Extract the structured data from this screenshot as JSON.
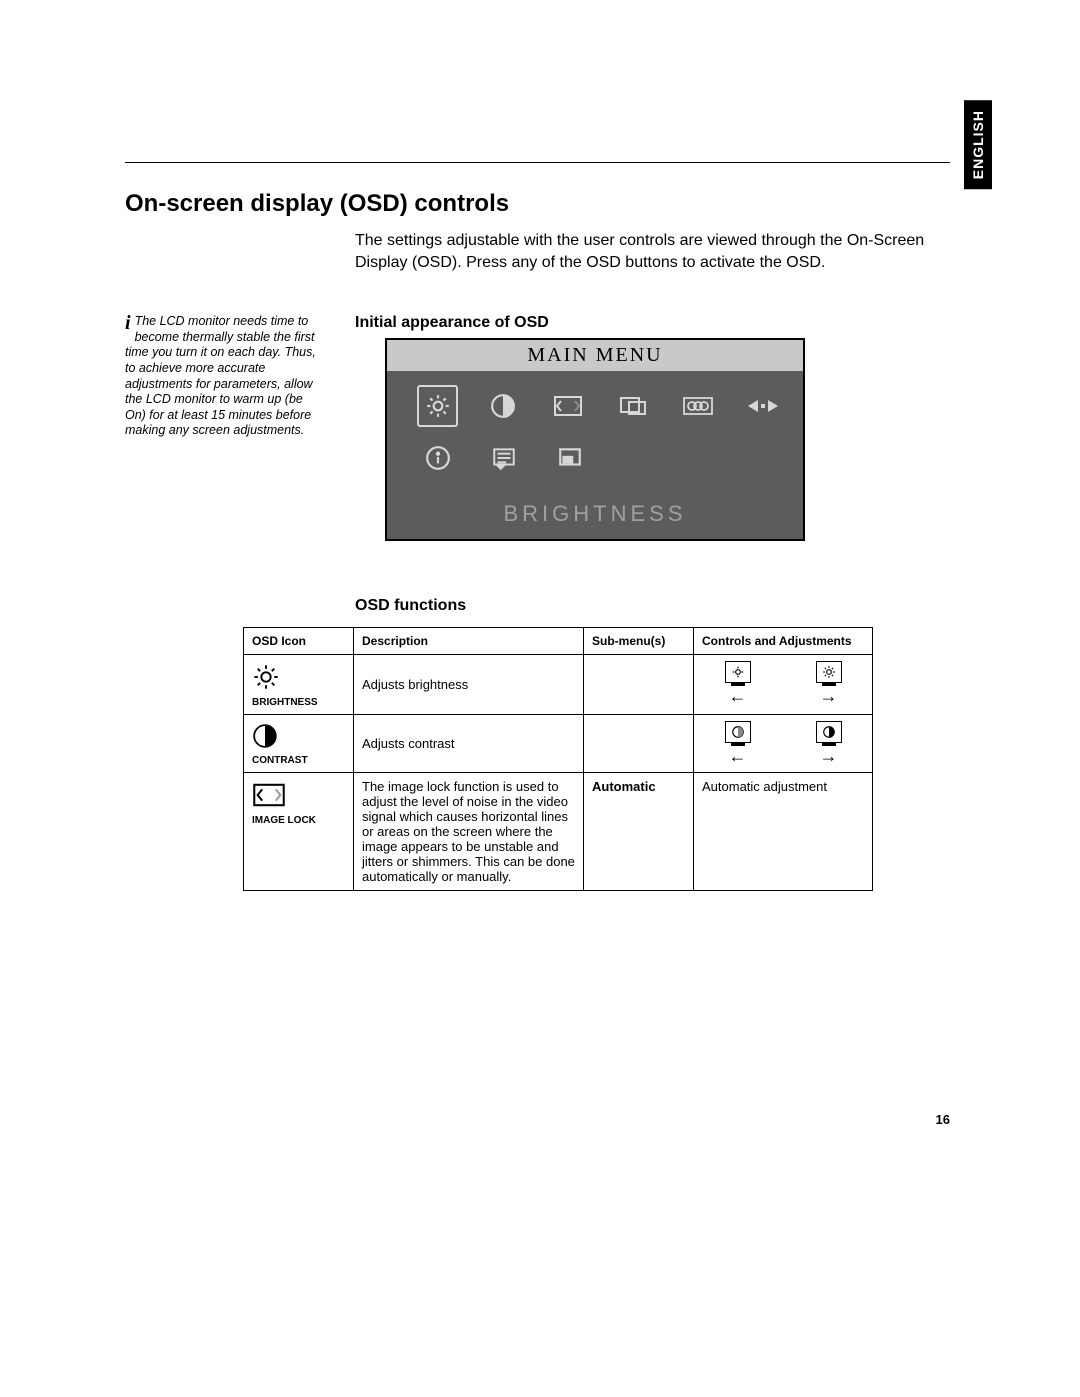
{
  "language_tab": "ENGLISH",
  "title": "On-screen display (OSD) controls",
  "intro": "The settings adjustable with the user controls are viewed through the On-Screen Display (OSD). Press any of the OSD buttons to activate the OSD.",
  "sidenote": "The LCD monitor needs time to become thermally stable the first time you turn it on each day. Thus, to achieve more accurate adjustments for parameters, allow the LCD monitor to warm up (be On) for at least 15 minutes before making any screen adjustments.",
  "sub_initial": "Initial appearance of OSD",
  "sub_functions": "OSD functions",
  "osd_window": {
    "title": "MAIN MENU",
    "footer": "BRIGHTNESS"
  },
  "table": {
    "headers": {
      "icon": "OSD Icon",
      "desc": "Description",
      "sub": "Sub-menu(s)",
      "adj": "Controls and Adjustments"
    },
    "rows": [
      {
        "label": "BRIGHTNESS",
        "desc": "Adjusts brightness",
        "sub": "",
        "adj_text": ""
      },
      {
        "label": "CONTRAST",
        "desc": "Adjusts contrast",
        "sub": "",
        "adj_text": ""
      },
      {
        "label": "IMAGE LOCK",
        "desc": "The image lock function is used to adjust the level of noise in the video signal which causes horizontal lines or areas on the screen where the image appears to be unstable and jitters or shimmers. This can be done automatically or manually.",
        "sub": "Automatic",
        "adj_text": "Automatic adjustment"
      }
    ]
  },
  "page_number": "16"
}
